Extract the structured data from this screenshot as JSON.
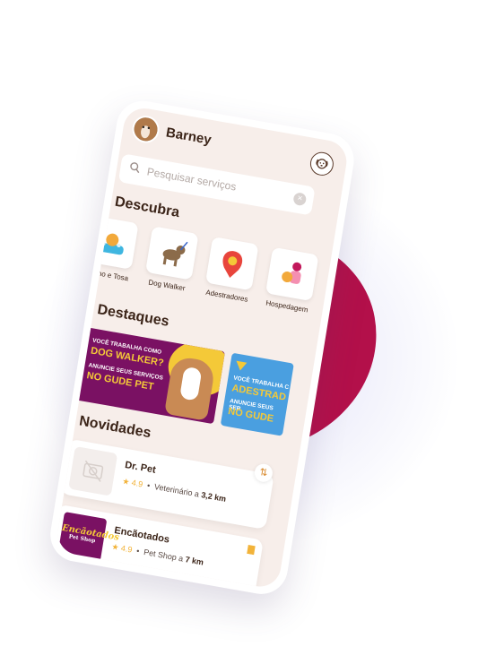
{
  "user": {
    "name": "Barney"
  },
  "search": {
    "placeholder": "Pesquisar serviços"
  },
  "sections": {
    "discover": "Descubra",
    "highlights": "Destaques",
    "news": "Novidades"
  },
  "categories": [
    {
      "label": "Banho e Tosa",
      "icon": "bath-dog-icon"
    },
    {
      "label": "Dog Walker",
      "icon": "dog-walker-icon"
    },
    {
      "label": "Adestradores",
      "icon": "trainer-icon"
    },
    {
      "label": "Hospedagem",
      "icon": "pet-hotel-icon"
    }
  ],
  "banners": [
    {
      "line1": "VOCÊ TRABALHA COMO",
      "line2": "DOG WALKER?",
      "line3": "ANUNCIE SEUS SERVIÇOS",
      "line4": "NO GUDE PET"
    },
    {
      "line1": "VOCÊ TRABALHA C",
      "line2": "ADESTRAD",
      "line3": "ANUNCIE SEUS SER",
      "line4": "NO GUDE"
    }
  ],
  "listings": [
    {
      "name": "Dr. Pet",
      "rating": "4.9",
      "category": "Veterinário a",
      "distance": "3,2 km"
    },
    {
      "name": "Encãotados",
      "rating": "4.9",
      "category": "Pet Shop a",
      "distance": "7 km",
      "logo_text": "Encãotados",
      "logo_sub": "Pet Shop"
    }
  ],
  "colors": {
    "brand": "#7a1163",
    "accent": "#f4c938",
    "background": "#f7eeea",
    "blob": "#b3104a"
  }
}
